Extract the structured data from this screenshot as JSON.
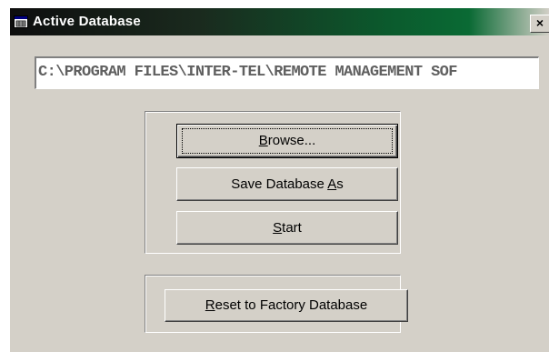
{
  "window": {
    "title": "Active Database",
    "close_glyph": "×"
  },
  "path_field": {
    "value": "C:\\PROGRAM FILES\\INTER-TEL\\REMOTE MANAGEMENT SOF"
  },
  "buttons": {
    "browse": {
      "mnemonic": "B",
      "rest": "rowse..."
    },
    "save_as": {
      "before": "Save Database ",
      "mnemonic": "A",
      "rest": "s"
    },
    "start": {
      "mnemonic": "S",
      "rest": "tart"
    },
    "reset": {
      "mnemonic": "R",
      "rest": "eset to Factory Database"
    }
  },
  "icons": {
    "title_icon": "database-window-icon",
    "close": "close-icon"
  }
}
